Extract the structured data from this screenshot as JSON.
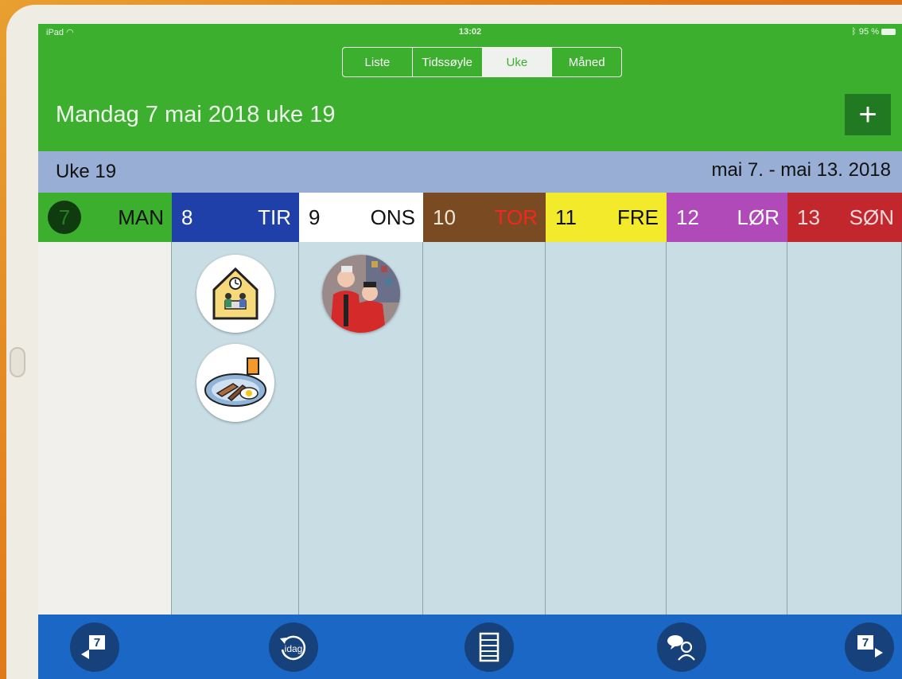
{
  "status": {
    "device": "iPad",
    "time": "13:02",
    "battery": "95 %"
  },
  "view_switcher": {
    "options": [
      "Liste",
      "Tidssøyle",
      "Uke",
      "Måned"
    ],
    "selected": "Uke"
  },
  "header": {
    "title": "Mandag 7 mai 2018 uke 19",
    "add_label": "+"
  },
  "week": {
    "label": "Uke 19",
    "range": "mai 7. - mai 13. 2018"
  },
  "days": [
    {
      "num": "7",
      "name": "MAN",
      "bg": "#3caf2f",
      "color": "#111111",
      "today": true
    },
    {
      "num": "8",
      "name": "TIR",
      "bg": "#1f40a8",
      "color": "#ffffff",
      "today": false
    },
    {
      "num": "9",
      "name": "ONS",
      "bg": "#ffffff",
      "color": "#111111",
      "today": false
    },
    {
      "num": "10",
      "name": "TOR",
      "bg": "#7a4a22",
      "color": "#f2271d",
      "num_color": "#f2e8d8",
      "today": false
    },
    {
      "num": "11",
      "name": "FRE",
      "bg": "#f2ea2a",
      "color": "#111111",
      "today": false
    },
    {
      "num": "12",
      "name": "LØR",
      "bg": "#b04ab8",
      "color": "#ffffff",
      "today": false
    },
    {
      "num": "13",
      "name": "SØN",
      "bg": "#c1272d",
      "color": "#f6d9d9",
      "today": false
    }
  ],
  "events": [
    {
      "day": "TIR",
      "icon": "meeting-room-icon"
    },
    {
      "day": "TIR",
      "icon": "breakfast-plate-icon"
    },
    {
      "day": "ONS",
      "icon": "people-photo-icon"
    }
  ],
  "toolbar": {
    "prev_week_icon": "prev-week-icon",
    "today_label": "idag",
    "list_icon": "list-icon",
    "contacts_icon": "contacts-icon",
    "next_week_icon": "next-week-icon",
    "week_badge": "7"
  }
}
